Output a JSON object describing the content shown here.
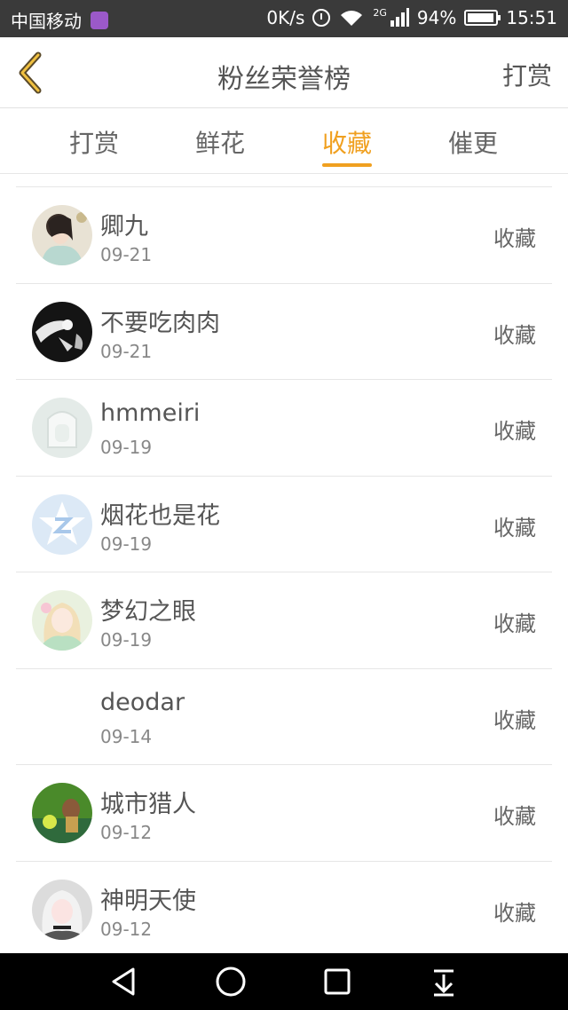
{
  "status_bar": {
    "carrier": "中国移动",
    "speed": "0K/s",
    "network": "2G",
    "battery": "94%",
    "battery_level": 0.94,
    "time": "15:51"
  },
  "header": {
    "title": "粉丝荣誉榜",
    "action_label": "打赏",
    "accent_color": "#f0a020"
  },
  "tabs": [
    {
      "label": "打赏",
      "active": false
    },
    {
      "label": "鲜花",
      "active": false
    },
    {
      "label": "收藏",
      "active": true
    },
    {
      "label": "催更",
      "active": false
    }
  ],
  "items": [
    {
      "name": "卿九",
      "date": "09-21",
      "action": "收藏",
      "avatar": "girl-illustration"
    },
    {
      "name": "不要吃肉肉",
      "date": "09-21",
      "action": "收藏",
      "avatar": "dark-sketch"
    },
    {
      "name": "hmmeiri",
      "date": "09-19",
      "action": "收藏",
      "avatar": "default-placeholder"
    },
    {
      "name": "烟花也是花",
      "date": "09-19",
      "action": "收藏",
      "avatar": "star-logo"
    },
    {
      "name": "梦幻之眼",
      "date": "09-19",
      "action": "收藏",
      "avatar": "anime-girl"
    },
    {
      "name": "deodar",
      "date": "09-14",
      "action": "收藏",
      "avatar": "none"
    },
    {
      "name": "城市猎人",
      "date": "09-12",
      "action": "收藏",
      "avatar": "game-character"
    },
    {
      "name": "神明天使",
      "date": "09-12",
      "action": "收藏",
      "avatar": "white-hair-character"
    }
  ],
  "nav": {
    "buttons": [
      "back-icon",
      "home-icon",
      "recents-icon",
      "notification-pull-icon"
    ]
  }
}
